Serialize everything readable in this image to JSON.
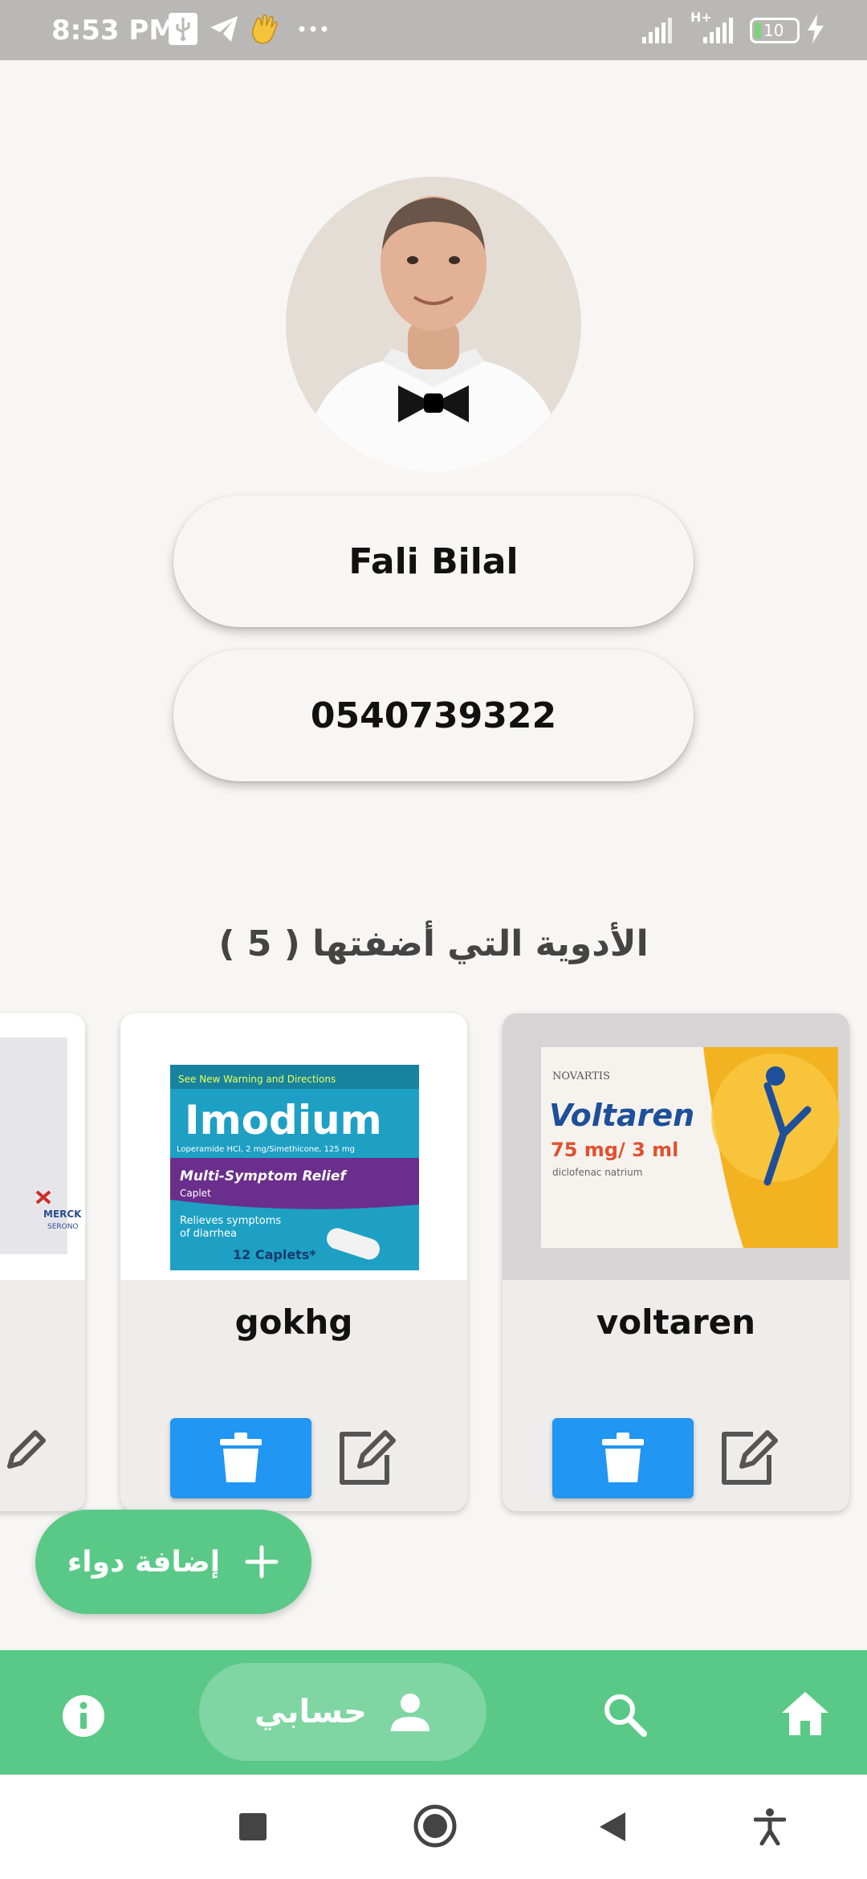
{
  "status_bar": {
    "time": "8:53 PM",
    "network_label": "H+",
    "battery": "10"
  },
  "profile": {
    "name": "Fali Bilal",
    "phone": "0540739322"
  },
  "medicines_section": {
    "title": "الأدوية التي أضفتها ( 5 )"
  },
  "medicines": [
    {
      "name": "voltaren",
      "image_icon": "voltaren-box-image"
    },
    {
      "name": "gokhg",
      "image_icon": "imodium-box-image"
    },
    {
      "name": "",
      "image_icon": "merck-box-image"
    }
  ],
  "fab": {
    "label": "إضافة دواء",
    "icon": "plus-icon"
  },
  "bottom_nav": {
    "active_label": "حسابي",
    "items": [
      "home-icon",
      "search-icon",
      "person-icon",
      "info-icon"
    ]
  },
  "colors": {
    "accent_green": "#5ac987",
    "nav_active": "#7fd6a3",
    "delete_blue": "#2196f3",
    "status_bar": "#b9b8b6",
    "background": "#f7f6f4"
  }
}
